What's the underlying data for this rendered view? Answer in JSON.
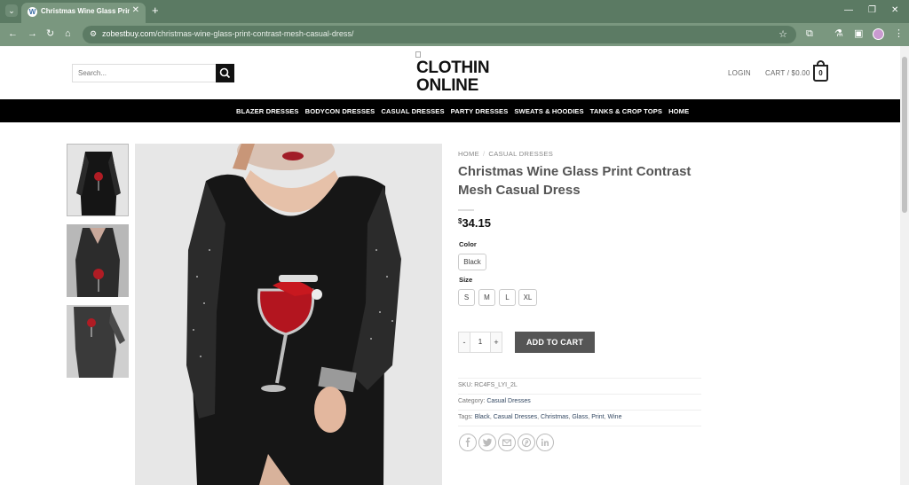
{
  "browser": {
    "tab_title": "Christmas Wine Glass Print Co",
    "tab_favicon": "W",
    "url_domain": "zobestbuy.com",
    "url_path": "/christmas-wine-glass-print-contrast-mesh-casual-dress/"
  },
  "header": {
    "search_placeholder": "Search...",
    "logo_line1": "CLOTHIN",
    "logo_line2": "ONLINE",
    "login": "LOGIN",
    "cart": "CART / $0.00",
    "cart_count": "0"
  },
  "nav": [
    "BLAZER DRESSES",
    "BODYCON DRESSES",
    "CASUAL DRESSES",
    "PARTY DRESSES",
    "SWEATS & HOODIES",
    "TANKS & CROP TOPS",
    "HOME"
  ],
  "product": {
    "breadcrumb": [
      "HOME",
      "CASUAL DRESSES"
    ],
    "breadcrumb_sep": "/",
    "title": "Christmas Wine Glass Print Contrast Mesh Casual Dress",
    "currency": "$",
    "price": "34.15",
    "color_label": "Color",
    "colors": [
      "Black"
    ],
    "size_label": "Size",
    "sizes": [
      "S",
      "M",
      "L",
      "XL"
    ],
    "qty_minus": "-",
    "qty_value": "1",
    "qty_plus": "+",
    "add_to_cart": "ADD TO CART",
    "sku_label": "SKU:",
    "sku": "RC4FS_LYI_2L",
    "category_label": "Category:",
    "category": "Casual Dresses",
    "tags_label": "Tags:",
    "tags": [
      "Black",
      "Casual Dresses",
      "Christmas",
      "Glass",
      "Print",
      "Wine"
    ]
  },
  "share_icons": [
    "facebook-icon",
    "twitter-icon",
    "email-icon",
    "pinterest-icon",
    "linkedin-icon"
  ],
  "colors": {
    "chrome_dark": "#5b7a63",
    "chrome_light": "#7a977f",
    "nav_bg": "#000000",
    "add_cart_bg": "#555555",
    "link": "#334862"
  }
}
